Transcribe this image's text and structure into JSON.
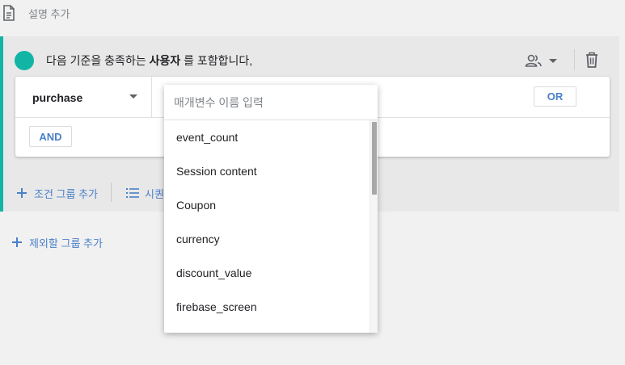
{
  "header": {
    "description_label": "설명 추가",
    "doc_icon": "document-icon"
  },
  "group": {
    "accent_color": "#12b5a5",
    "title_prefix": "다음 기준을 충족하는",
    "title_bold": "사용자",
    "title_suffix": "를 포함합니다,",
    "scope_icon": "people-icon",
    "delete_icon": "trash-icon"
  },
  "condition": {
    "event_name": "purchase",
    "or_label": "OR",
    "and_label": "AND"
  },
  "actions": {
    "add_condition_group": "조건 그룹 추가",
    "add_sequence": "시퀀",
    "add_exclude_group": "제외할 그룹 추가"
  },
  "dropdown": {
    "placeholder": "매개변수 이름 입력",
    "value": "",
    "items": [
      "event_count",
      "Session content",
      "Coupon",
      "currency",
      "discount_value",
      "firebase_screen"
    ]
  },
  "colors": {
    "link_blue": "#4a7fc9",
    "panel_bg": "#e8e8e8",
    "page_bg": "#f1f1f1"
  }
}
